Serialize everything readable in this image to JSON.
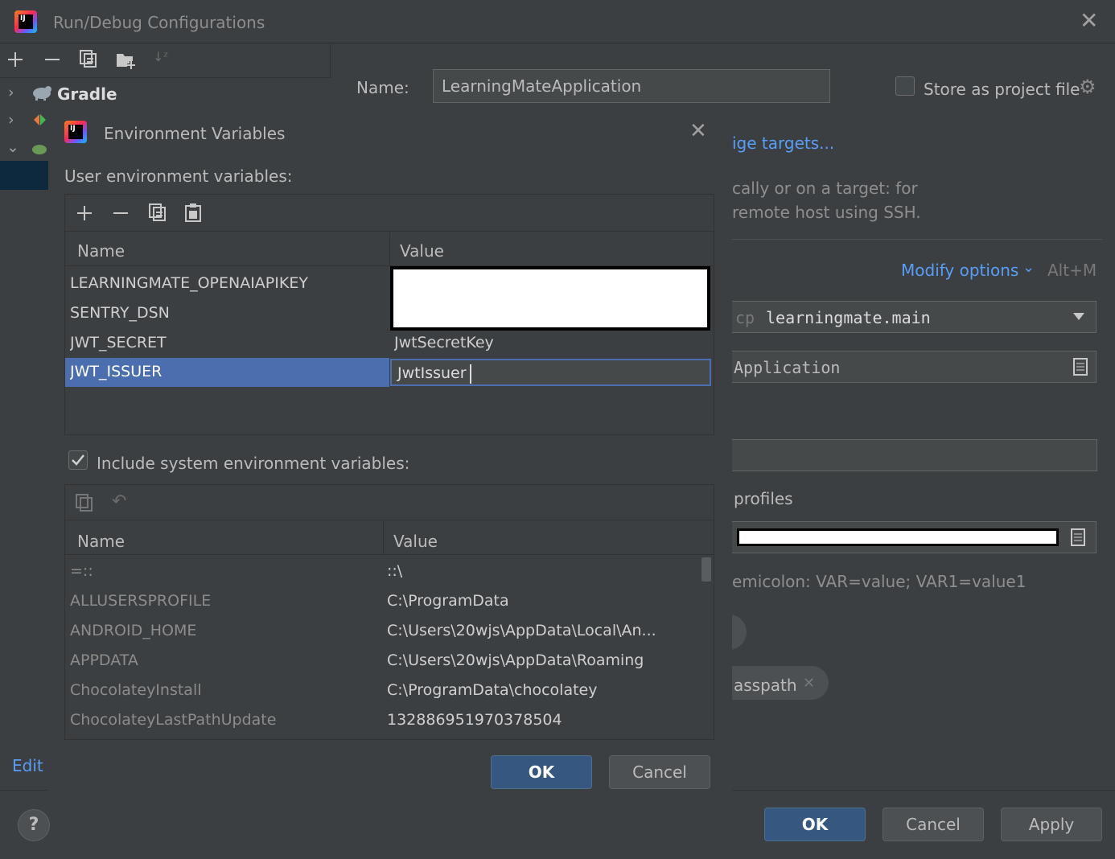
{
  "window": {
    "title": "Run/Debug Configurations",
    "toolbar_icons": [
      "add-icon",
      "remove-icon",
      "copy-icon",
      "new-folder-icon",
      "sort-icon"
    ]
  },
  "tree": {
    "gradle_label": "Gradle",
    "edit_link": "Edit"
  },
  "config": {
    "name_label": "Name:",
    "name_value": "LearningMateApplication",
    "store_label": "Store as project file",
    "manage_targets": "ige targets...",
    "target_hint_1": "cally or on a target: for",
    "target_hint_2": "remote host using SSH.",
    "modify_options": "Modify options",
    "modify_shortcut": "Alt+M",
    "classpath_prefix": "cp",
    "classpath_value": "learningmate.main",
    "main_class": "Application",
    "profiles_label": "profiles",
    "env_hint": "emicolon: VAR=value; VAR1=value1",
    "classpath_chip": "asspath"
  },
  "env_dialog": {
    "title": "Environment Variables",
    "user_section_label": "User environment variables:",
    "columns": {
      "name": "Name",
      "value": "Value"
    },
    "user_vars": [
      {
        "name": "LEARNINGMATE_OPENAIAPIKEY",
        "value": ""
      },
      {
        "name": "SENTRY_DSN",
        "value": ""
      },
      {
        "name": "JWT_SECRET",
        "value": "JwtSecretKey"
      },
      {
        "name": "JWT_ISSUER",
        "value": "JwtIssuer"
      }
    ],
    "include_system_label": "Include system environment variables:",
    "include_system_checked": true,
    "system_vars": [
      {
        "name": "=::",
        "value": "::\\"
      },
      {
        "name": "ALLUSERSPROFILE",
        "value": "C:\\ProgramData"
      },
      {
        "name": "ANDROID_HOME",
        "value": "C:\\Users\\20wjs\\AppData\\Local\\An..."
      },
      {
        "name": "APPDATA",
        "value": "C:\\Users\\20wjs\\AppData\\Roaming"
      },
      {
        "name": "ChocolateyInstall",
        "value": "C:\\ProgramData\\chocolatey"
      },
      {
        "name": "ChocolateyLastPathUpdate",
        "value": "132886951970378504"
      }
    ],
    "ok_label": "OK",
    "cancel_label": "Cancel"
  },
  "footer": {
    "help_label": "?",
    "ok_label": "OK",
    "cancel_label": "Cancel",
    "apply_label": "Apply"
  },
  "colors": {
    "background": "#3c3f41",
    "selection": "#4b6eaf",
    "link": "#589df6",
    "primary_button": "#365880"
  }
}
